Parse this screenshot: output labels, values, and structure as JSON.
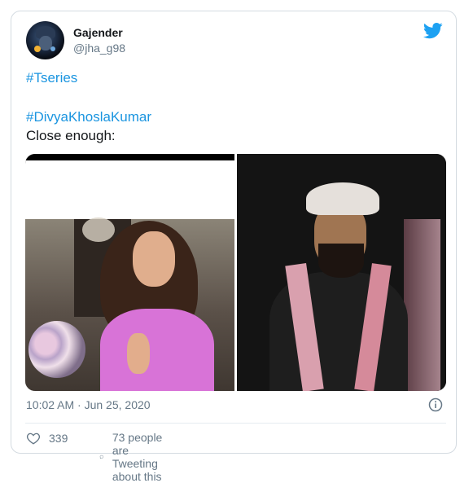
{
  "tweet": {
    "author_name": "Gajender",
    "author_handle": "@jha_g98",
    "lines": [
      "#Tseries",
      "#DivyaKhoslaKumar",
      "Close enough:"
    ],
    "timestamp": "10:02 AM · Jun 25, 2020",
    "likes": "339",
    "tweeting_about": "73 people are Tweeting about this"
  },
  "icons": {
    "brand": "twitter-bird-icon",
    "info": "info-icon",
    "like": "heart-icon",
    "reply": "speech-bubble-icon"
  },
  "colors": {
    "accent": "#1da1f2",
    "hashtag": "#1b95e0",
    "muted": "#657786"
  }
}
